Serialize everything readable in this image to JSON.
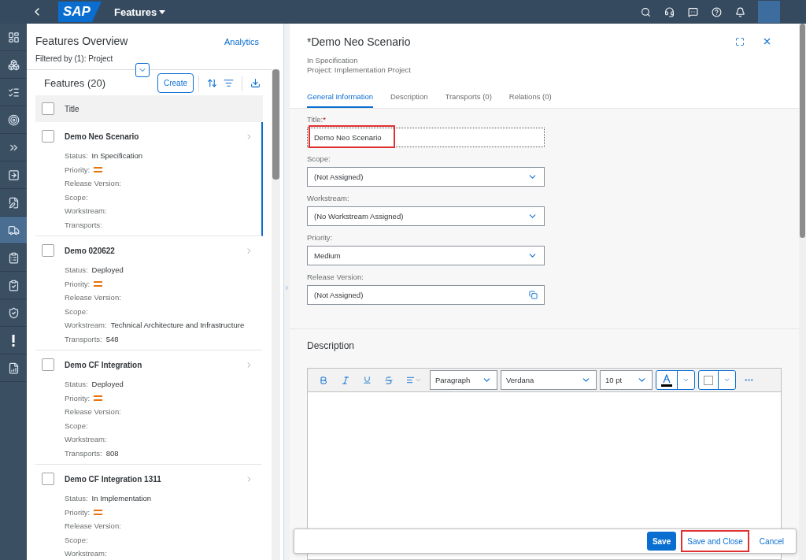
{
  "shell": {
    "logo": "SAP",
    "title": "Features"
  },
  "nav": [
    {
      "selected": false
    },
    {
      "selected": false
    },
    {
      "selected": false
    },
    {
      "selected": false
    },
    {
      "selected": false
    },
    {
      "selected": false
    },
    {
      "selected": false
    },
    {
      "selected": true
    },
    {
      "selected": false
    },
    {
      "selected": false
    },
    {
      "selected": false
    },
    {
      "selected": false
    },
    {
      "selected": false
    }
  ],
  "list_panel": {
    "all_checked": false,
    "title": "Features Overview",
    "link": "Analytics",
    "filter": "Filtered by (1): Project",
    "list_title": "Features (20)",
    "create": "Create",
    "column": "Title",
    "items": [
      {
        "title": "Demo Neo Scenario",
        "selected": true,
        "checked": false,
        "fields": [
          {
            "label": "Status:",
            "value": "In Specification"
          },
          {
            "label": "Priority:",
            "kind": "priority"
          },
          {
            "label": "Release Version:"
          },
          {
            "label": "Scope:"
          },
          {
            "label": "Workstream:"
          },
          {
            "label": "Transports:"
          }
        ]
      },
      {
        "title": "Demo 020622",
        "selected": false,
        "checked": false,
        "fields": [
          {
            "label": "Status:",
            "value": "Deployed"
          },
          {
            "label": "Priority:",
            "kind": "priority"
          },
          {
            "label": "Release Version:"
          },
          {
            "label": "Scope:"
          },
          {
            "label": "Workstream:",
            "value": "Technical Architecture and Infrastructure"
          },
          {
            "label": "Transports:",
            "value": "548"
          }
        ]
      },
      {
        "title": "Demo CF Integration",
        "selected": false,
        "checked": false,
        "fields": [
          {
            "label": "Status:",
            "value": "Deployed"
          },
          {
            "label": "Priority:",
            "kind": "priority"
          },
          {
            "label": "Release Version:"
          },
          {
            "label": "Scope:"
          },
          {
            "label": "Workstream:"
          },
          {
            "label": "Transports:",
            "value": "808"
          }
        ]
      },
      {
        "title": "Demo CF Integration 1311",
        "selected": false,
        "checked": false,
        "fields": [
          {
            "label": "Status:",
            "value": "In Implementation"
          },
          {
            "label": "Priority:",
            "kind": "priority"
          },
          {
            "label": "Release Version:"
          },
          {
            "label": "Scope:"
          },
          {
            "label": "Workstream:"
          }
        ]
      }
    ]
  },
  "detail": {
    "title": "*Demo Neo Scenario",
    "status": "In Specification",
    "project": "Project: Implementation Project",
    "tabs": [
      {
        "label": "General Information",
        "selected": true
      },
      {
        "label": "Description",
        "selected": false
      },
      {
        "label": "Transports (0)",
        "selected": false
      },
      {
        "label": "Relations (0)",
        "selected": false
      }
    ],
    "fields": [
      {
        "label": "Title:",
        "required_mark": "*",
        "kind": "text",
        "value": "Demo Neo Scenario",
        "highlighted": true
      },
      {
        "label": "Scope:",
        "kind": "select",
        "value": "(Not Assigned)"
      },
      {
        "label": "Workstream:",
        "kind": "select",
        "value": "(No Workstream Assigned)"
      },
      {
        "label": "Priority:",
        "kind": "select",
        "value": "Medium"
      },
      {
        "label": "Release Version:",
        "kind": "valuehelp",
        "value": "(Not Assigned)"
      }
    ],
    "description_heading": "Description",
    "editor": {
      "block": "Paragraph",
      "font": "Verdana",
      "size": "10 pt"
    },
    "footer": [
      {
        "label": "Save",
        "kind": "emphasized",
        "highlighted": false
      },
      {
        "label": "Save and Close",
        "kind": "link",
        "highlighted": true
      },
      {
        "label": "Cancel",
        "kind": "link",
        "highlighted": false
      }
    ]
  }
}
